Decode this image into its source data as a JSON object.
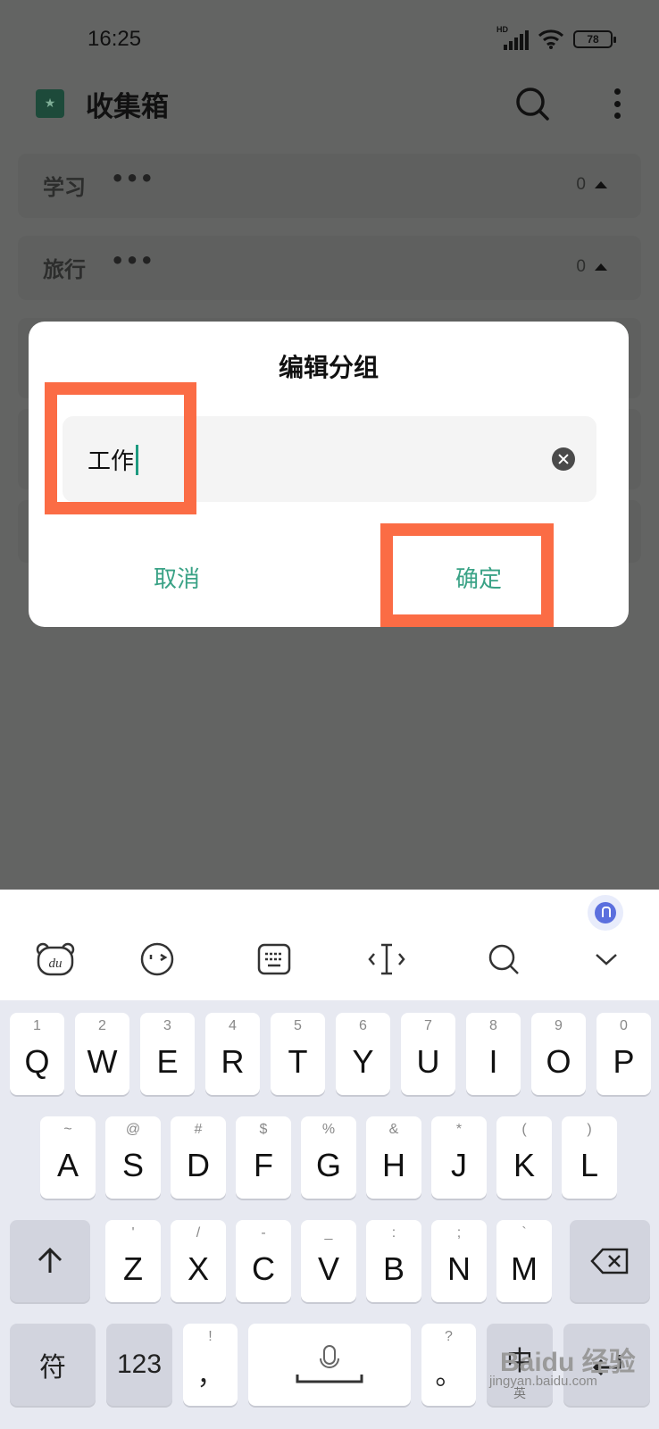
{
  "status_bar": {
    "time": "16:25",
    "network_badge": "HD",
    "battery": "78"
  },
  "app": {
    "title": "收集箱",
    "search_icon": "search-icon",
    "more_icon": "more-vertical-icon"
  },
  "groups": [
    {
      "name": "学习",
      "menu": "•••",
      "count": "0"
    },
    {
      "name": "旅行",
      "menu": "•••",
      "count": "0"
    }
  ],
  "dialog": {
    "title": "编辑分组",
    "input_value": "工作",
    "cancel_label": "取消",
    "confirm_label": "确定"
  },
  "annotation": {
    "color": "#fb6c45"
  },
  "keyboard": {
    "toolbar_icons": [
      "bear-du-icon",
      "emoji-icon",
      "keyboard-layout-icon",
      "cursor-move-icon",
      "search-icon",
      "collapse-chevron-icon"
    ],
    "row1": [
      {
        "hint": "1",
        "letter": "Q"
      },
      {
        "hint": "2",
        "letter": "W"
      },
      {
        "hint": "3",
        "letter": "E"
      },
      {
        "hint": "4",
        "letter": "R"
      },
      {
        "hint": "5",
        "letter": "T"
      },
      {
        "hint": "6",
        "letter": "Y"
      },
      {
        "hint": "7",
        "letter": "U"
      },
      {
        "hint": "8",
        "letter": "I"
      },
      {
        "hint": "9",
        "letter": "O"
      },
      {
        "hint": "0",
        "letter": "P"
      }
    ],
    "row2": [
      {
        "hint": "~",
        "letter": "A"
      },
      {
        "hint": "@",
        "letter": "S"
      },
      {
        "hint": "#",
        "letter": "D"
      },
      {
        "hint": "$",
        "letter": "F"
      },
      {
        "hint": "%",
        "letter": "G"
      },
      {
        "hint": "&",
        "letter": "H"
      },
      {
        "hint": "*",
        "letter": "J"
      },
      {
        "hint": "(",
        "letter": "K"
      },
      {
        "hint": ")",
        "letter": "L"
      }
    ],
    "row3": [
      {
        "hint": "'",
        "letter": "Z"
      },
      {
        "hint": "/",
        "letter": "X"
      },
      {
        "hint": "-",
        "letter": "C"
      },
      {
        "hint": "_",
        "letter": "V"
      },
      {
        "hint": ":",
        "letter": "B"
      },
      {
        "hint": ";",
        "letter": "N"
      },
      {
        "hint": "`",
        "letter": "M"
      }
    ],
    "symbol_key": "符",
    "number_key": "123",
    "comma_hint": "!",
    "comma_key": "，",
    "period_hint": "?",
    "period_key": "。",
    "lang_key": "中",
    "lang_sub": "英"
  },
  "watermark": {
    "logo": "Baidu 经验",
    "url": "jingyan.baidu.com"
  }
}
